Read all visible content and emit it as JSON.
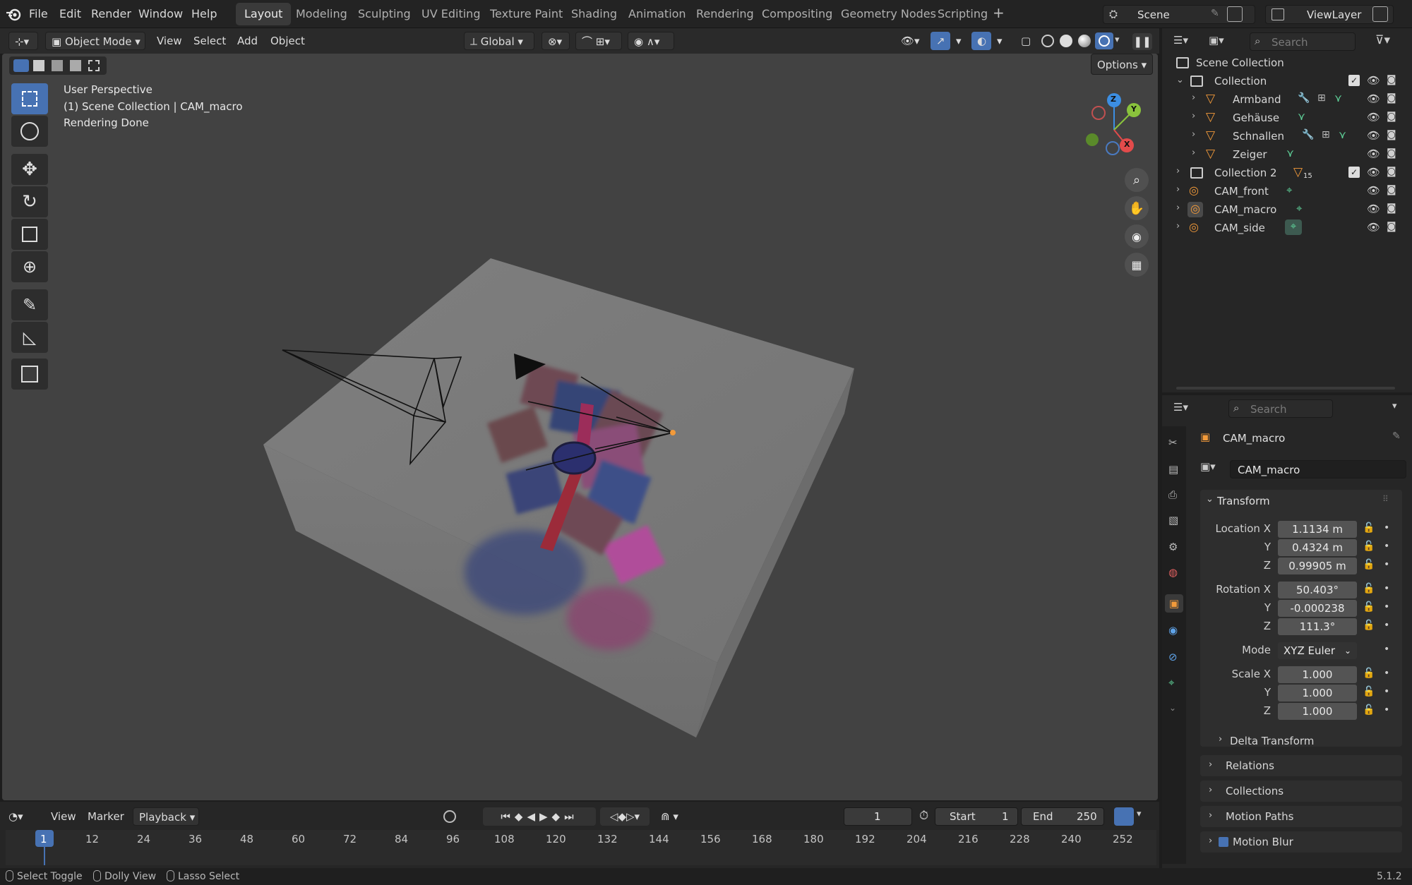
{
  "top_menu": {
    "items": [
      "File",
      "Edit",
      "Render",
      "Window",
      "Help"
    ]
  },
  "workspace_tabs": [
    "Layout",
    "Modeling",
    "Sculpting",
    "UV Editing",
    "Texture Paint",
    "Shading",
    "Animation",
    "Rendering",
    "Compositing",
    "Geometry Nodes",
    "Scripting"
  ],
  "active_tab": "Layout",
  "scene": {
    "label": "Scene",
    "view_layer": "ViewLayer"
  },
  "viewport_header": {
    "mode": "Object Mode",
    "menus": [
      "View",
      "Select",
      "Add",
      "Object"
    ],
    "transform_orientation": "Global",
    "options": "Options"
  },
  "viewport_overlay_text": [
    "User Perspective",
    "(1) Scene Collection | CAM_macro",
    "Rendering Done"
  ],
  "gizmo_axes": {
    "x": "X",
    "y": "Y",
    "z": "Z"
  },
  "outliner": {
    "search_placeholder": "Search",
    "root": "Scene Collection",
    "items": [
      {
        "label": "Collection",
        "indent": 0,
        "type": "collection"
      },
      {
        "label": "Armband",
        "indent": 1,
        "type": "mesh"
      },
      {
        "label": "Gehäuse",
        "indent": 1,
        "type": "mesh"
      },
      {
        "label": "Schnallen",
        "indent": 1,
        "type": "mesh"
      },
      {
        "label": "Zeiger",
        "indent": 1,
        "type": "mesh"
      },
      {
        "label": "Collection 2",
        "indent": 0,
        "type": "collection",
        "badge": "15"
      },
      {
        "label": "CAM_front",
        "indent": 0,
        "type": "camera"
      },
      {
        "label": "CAM_macro",
        "indent": 0,
        "type": "camera"
      },
      {
        "label": "CAM_side",
        "indent": 0,
        "type": "camera"
      }
    ]
  },
  "properties": {
    "search_placeholder": "Search",
    "object_name": "CAM_macro",
    "datablock_name": "CAM_macro",
    "transform_title": "Transform",
    "location": {
      "label": "Location X",
      "x": "1.1134 m",
      "y": "0.4324 m",
      "z": "0.99905 m"
    },
    "rotation": {
      "label": "Rotation X",
      "x": "50.403°",
      "y": "-0.000238",
      "z": "111.3°"
    },
    "mode": {
      "label": "Mode",
      "value": "XYZ Euler"
    },
    "scale": {
      "label": "Scale X",
      "x": "1.000",
      "y": "1.000",
      "z": "1.000"
    },
    "axis_y": "Y",
    "axis_z": "Z",
    "sub_panels": [
      "Delta Transform"
    ],
    "panels": [
      "Relations",
      "Collections",
      "Motion Paths",
      "Motion Blur"
    ]
  },
  "timeline": {
    "menus": [
      "View",
      "Marker",
      "Playback"
    ],
    "current_frame": "1",
    "start_label": "Start",
    "start": "1",
    "end_label": "End",
    "end": "250",
    "ticks": [
      "1",
      "12",
      "24",
      "36",
      "48",
      "60",
      "72",
      "84",
      "96",
      "108",
      "120",
      "132",
      "144",
      "156",
      "168",
      "180",
      "192",
      "204",
      "216",
      "228",
      "240",
      "252"
    ]
  },
  "status_bar": {
    "left": [
      "Select Toggle",
      "Dolly View",
      "Lasso Select"
    ],
    "version": "5.1.2"
  },
  "colors": {
    "accent": "#4772b3",
    "x_axis": "#e24b4b",
    "y_axis": "#8ac33c",
    "z_axis": "#3c8ee2",
    "camera_orange": "#f29a3a"
  }
}
